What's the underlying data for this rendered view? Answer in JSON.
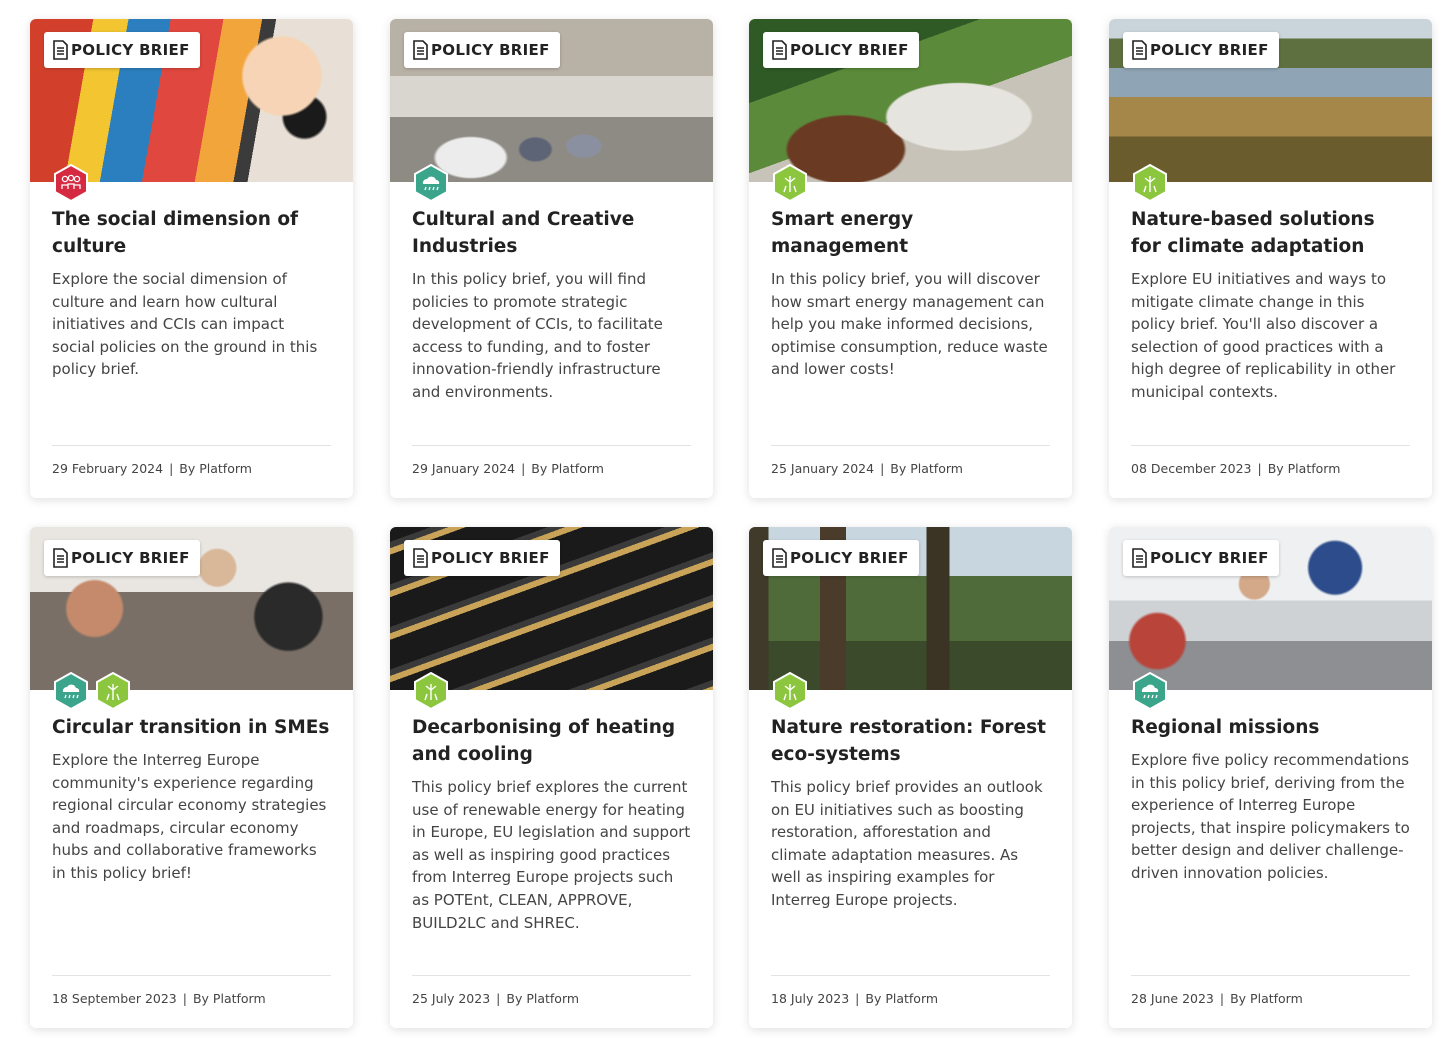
{
  "badge_label": "POLICY BRIEF",
  "colors": {
    "culture_hex": "#d62a43",
    "blue_green_hex": "#3aa58a",
    "green_hex": "#8cc63f"
  },
  "cards": [
    {
      "title": "The social dimension of culture",
      "description": "Explore the social dimension of culture and learn how cultural initiatives and CCIs can impact social policies on the ground in this policy brief.",
      "date": "29 February 2024",
      "author": "By Platform",
      "topics": [
        "people-icon"
      ]
    },
    {
      "title": "Cultural and Creative Industries",
      "description": "In this policy brief, you will find policies to promote strategic development of CCIs, to facilitate access to funding, and to foster innovation-friendly infrastructure and environments.",
      "date": "29 January 2024",
      "author": "By Platform",
      "topics": [
        "cloud-icon"
      ]
    },
    {
      "title": "Smart energy management",
      "description": "In this policy brief, you will discover how smart energy management can help you make informed decisions, optimise consumption, reduce waste and lower costs!",
      "date": "25 January 2024",
      "author": "By Platform",
      "topics": [
        "wind-turbine-icon"
      ]
    },
    {
      "title": "Nature-based solutions for climate adaptation",
      "description": "Explore EU initiatives and ways to mitigate climate change in this policy brief. You'll also discover a selection of good practices with a high degree of replicability in other municipal contexts.",
      "date": "08 December 2023",
      "author": "By Platform",
      "topics": [
        "wind-turbine-icon"
      ]
    },
    {
      "title": "Circular transition in SMEs",
      "description": "Explore the Interreg Europe community's experience regarding regional circular economy strategies and roadmaps, circular economy hubs and collaborative frameworks in this policy brief!",
      "date": "18 September 2023",
      "author": "By Platform",
      "topics": [
        "cloud-icon",
        "wind-turbine-icon"
      ]
    },
    {
      "title": "Decarbonising of heating and cooling",
      "description": "This policy brief explores the current use of renewable energy for heating in Europe, EU legislation and support as well as inspiring good practices from Interreg Europe projects such as POTEnt, CLEAN, APPROVE, BUILD2LC and SHREC.",
      "date": "25 July 2023",
      "author": "By Platform",
      "topics": [
        "wind-turbine-icon"
      ]
    },
    {
      "title": "Nature restoration: Forest eco-systems",
      "description": "This policy brief provides an outlook on EU initiatives such as boosting restoration, afforestation and climate adaptation measures. As well as inspiring examples for Interreg Europe projects.",
      "date": "18 July 2023",
      "author": "By Platform",
      "topics": [
        "wind-turbine-icon"
      ]
    },
    {
      "title": "Regional missions",
      "description": "Explore five policy recommendations in this policy brief, deriving from the experience of Interreg Europe projects, that inspire policymakers to better design and deliver challenge-driven innovation policies.",
      "date": "28 June 2023",
      "author": "By Platform",
      "topics": [
        "cloud-icon"
      ]
    }
  ]
}
